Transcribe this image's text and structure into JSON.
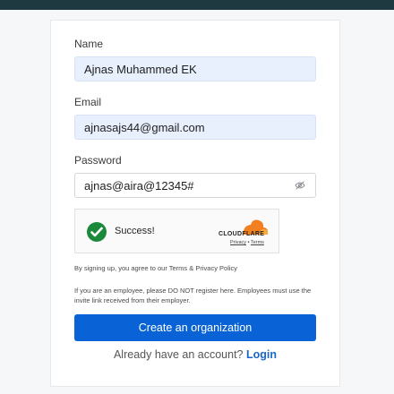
{
  "form": {
    "name": {
      "label": "Name",
      "value": "Ajnas Muhammed EK"
    },
    "email": {
      "label": "Email",
      "value": "ajnasajs44@gmail.com"
    },
    "password": {
      "label": "Password",
      "value": "ajnas@aira@12345#",
      "toggle_icon": "eye-slash-icon"
    },
    "captcha": {
      "status_icon": "check-circle-icon",
      "status_text": "Success!",
      "brand": "CLOUDFLARE",
      "privacy_link": "Privacy",
      "separator": "•",
      "terms_link": "Terms"
    },
    "agreement_text": "By signing up, you agree to our Terms & Privacy Policy",
    "employee_notice": "If you are an employee, please DO NOT register here. Employees must use the invite link received from their employer.",
    "submit_label": "Create an organization",
    "login_prompt": "Already have an account?",
    "login_link": "Login"
  },
  "colors": {
    "primary": "#0a63d6",
    "filled_input": "#e8f0fe",
    "success": "#1a8a3a",
    "cloudflare_orange": "#f38020",
    "header_bar": "#1e3a40"
  }
}
